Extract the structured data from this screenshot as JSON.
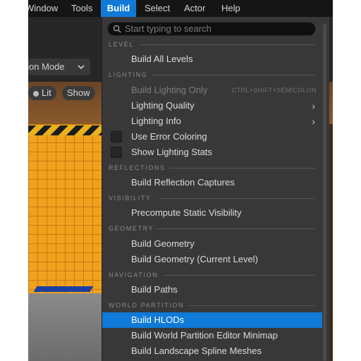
{
  "menubar": {
    "items": [
      {
        "label": "Window"
      },
      {
        "label": "Tools"
      },
      {
        "label": "Build"
      },
      {
        "label": "Select"
      },
      {
        "label": "Actor"
      },
      {
        "label": "Help"
      }
    ],
    "active": "Build"
  },
  "toolbar": {
    "mode_label": "Selection Mode"
  },
  "viewport": {
    "lit_label": "Lit",
    "show_label": "Show"
  },
  "menu": {
    "search_placeholder": "Start typing to search",
    "sections": {
      "level": "LEVEL",
      "lighting": "LIGHTING",
      "reflections": "REFLECTIONS",
      "visibility": "VISIBILITY",
      "geometry": "GEOMETRY",
      "navigation": "NAVIGATION",
      "world_partition": "WORLD PARTITION"
    },
    "items": {
      "build_all_levels": "Build All Levels",
      "build_lighting_only": "Build Lighting Only",
      "build_lighting_only_shortcut": "CTRL+SHIFT+SEMICOLON",
      "lighting_quality": "Lighting Quality",
      "lighting_info": "Lighting Info",
      "use_error_coloring": "Use Error Coloring",
      "show_lighting_stats": "Show Lighting Stats",
      "build_reflection_captures": "Build Reflection Captures",
      "precompute_static_visibility": "Precompute Static Visibility",
      "build_geometry": "Build Geometry",
      "build_geometry_current": "Build Geometry (Current Level)",
      "build_paths": "Build Paths",
      "build_hlods": "Build HLODs",
      "build_wp_minimap": "Build World Partition Editor Minimap",
      "build_landscape_spline": "Build Landscape Spline Meshes"
    },
    "highlighted": "Build HLODs",
    "colors": {
      "accent": "#0f7ad8",
      "menu_bg": "#383838"
    }
  }
}
